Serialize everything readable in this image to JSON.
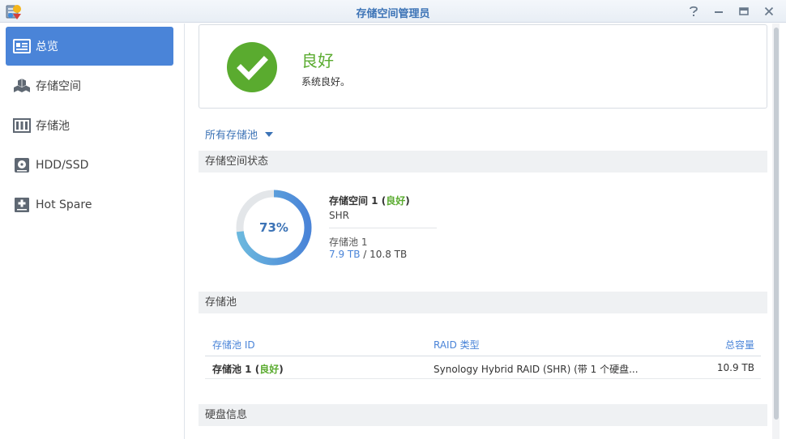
{
  "window": {
    "title": "存储空间管理员"
  },
  "sidebar": {
    "items": [
      {
        "label": "总览",
        "icon": "overview-icon",
        "active": true
      },
      {
        "label": "存储空间",
        "icon": "volume-icon",
        "active": false
      },
      {
        "label": "存储池",
        "icon": "storage-pool-icon",
        "active": false
      },
      {
        "label": "HDD/SSD",
        "icon": "hdd-icon",
        "active": false
      },
      {
        "label": "Hot Spare",
        "icon": "hot-spare-icon",
        "active": false
      }
    ]
  },
  "status": {
    "title": "良好",
    "description": "系统良好。",
    "color": "#5aab2f"
  },
  "filter": {
    "label": "所有存储池"
  },
  "volume_section": {
    "header": "存储空间状态",
    "usage_percent": 73,
    "usage_label": "73%",
    "volume_name": "存储空间 1",
    "status_open": " (",
    "status": "良好",
    "status_close": ")",
    "raid_type": "SHR",
    "pool": "存储池 1",
    "used": "7.9 TB",
    "separator": " / ",
    "total": "10.8 TB"
  },
  "pool_section": {
    "header": "存储池",
    "columns": [
      "存储池 ID",
      "RAID 类型",
      "总容量"
    ],
    "rows": [
      {
        "name": "存储池 1",
        "status_open": " (",
        "status": "良好",
        "status_close": ")",
        "raid": "Synology Hybrid RAID (SHR) (带 1 个硬盘...",
        "capacity": "10.9 TB"
      }
    ]
  },
  "disk_section": {
    "header": "硬盘信息"
  },
  "colors": {
    "accent": "#4a84d8",
    "good": "#5aab2f",
    "title_blue": "#3c73b6"
  }
}
